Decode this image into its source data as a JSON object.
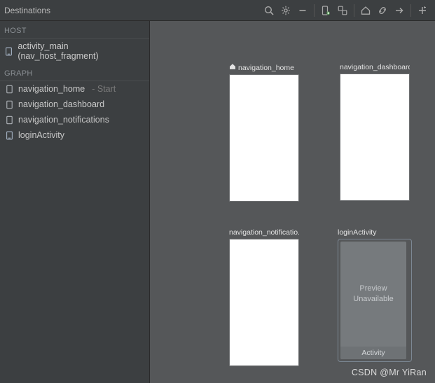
{
  "toolbar": {
    "title": "Destinations"
  },
  "sections": {
    "host_header": "HOST",
    "graph_header": "GRAPH"
  },
  "host": {
    "label": "activity_main (nav_host_fragment)"
  },
  "graph_items": [
    {
      "label": "navigation_home",
      "suffix": " - Start",
      "is_start": true,
      "kind": "fragment"
    },
    {
      "label": "navigation_dashboard",
      "suffix": "",
      "is_start": false,
      "kind": "fragment"
    },
    {
      "label": "navigation_notifications",
      "suffix": "",
      "is_start": false,
      "kind": "fragment"
    },
    {
      "label": "loginActivity",
      "suffix": "",
      "is_start": false,
      "kind": "activity"
    }
  ],
  "canvas": {
    "destinations": {
      "home": {
        "label": "navigation_home"
      },
      "dashboard": {
        "label": "navigation_dashboard"
      },
      "notifications": {
        "label": "navigation_notificatio..."
      },
      "login": {
        "label": "loginActivity",
        "preview_line1": "Preview",
        "preview_line2": "Unavailable",
        "footer": "Activity"
      }
    }
  },
  "watermark": "CSDN @Mr YiRan"
}
